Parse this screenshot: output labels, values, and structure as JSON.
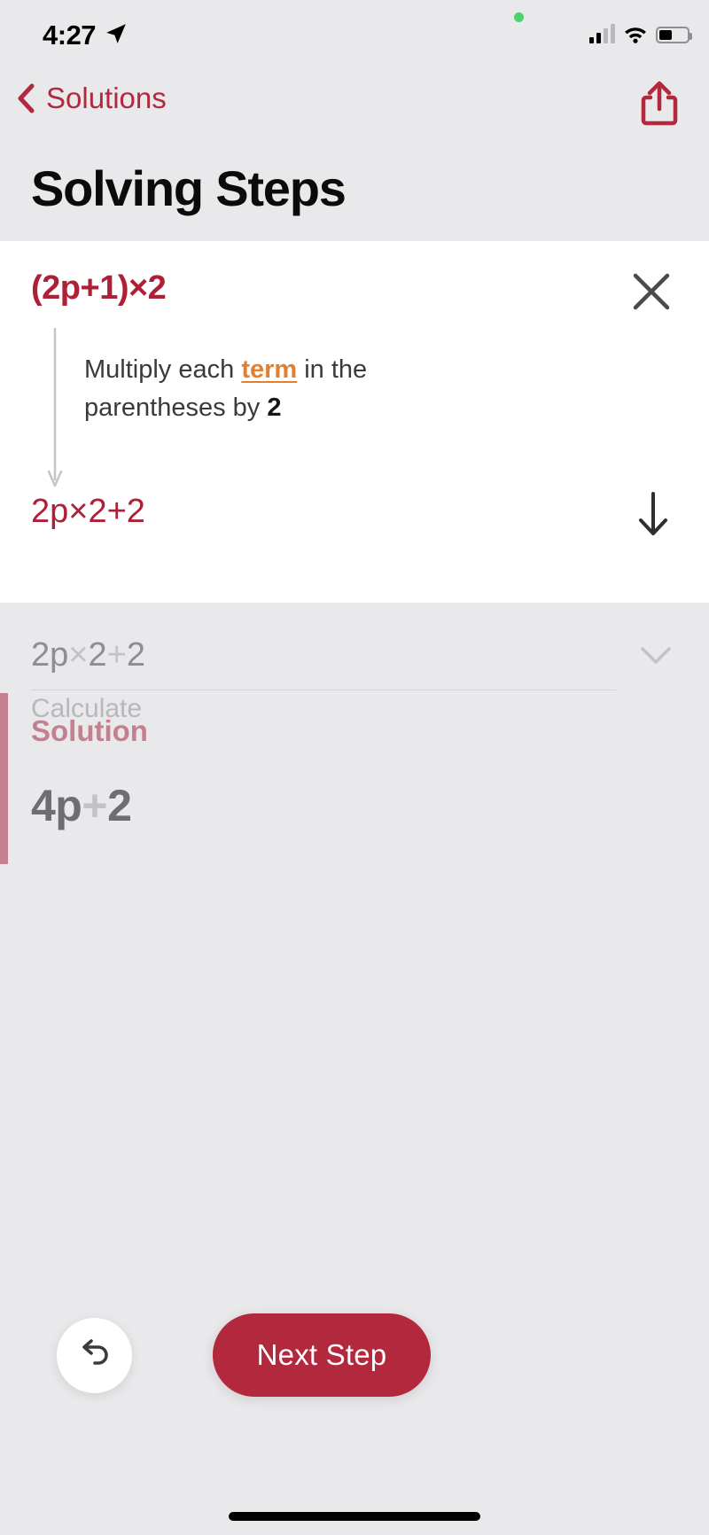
{
  "status_bar": {
    "time": "4:27",
    "location_icon": "location-arrow-icon",
    "recording_indicator": "green-recording-dot",
    "signal_icon": "cellular-signal-icon",
    "wifi_icon": "wifi-icon",
    "battery_icon": "battery-icon",
    "battery_level_percent": 45
  },
  "nav": {
    "back_label": "Solutions",
    "back_icon": "chevron-left-icon",
    "share_icon": "share-icon"
  },
  "header": {
    "title": "Solving Steps"
  },
  "active_step": {
    "expression": "(2p+1)×2",
    "close_icon": "close-x-icon",
    "description_prefix": "Multiply each ",
    "description_link": "term",
    "description_middle": " in the parentheses by ",
    "description_number": "2",
    "result": "2p×2+2",
    "down_icon": "arrow-down-icon",
    "flow_arrow_icon": "flow-arrow-down-icon"
  },
  "next_step": {
    "expression_a": "2p",
    "expression_times": "×",
    "expression_b": "2",
    "expression_plus": "+",
    "expression_c": "2",
    "label": "Calculate",
    "chevron_icon": "chevron-down-icon"
  },
  "solution": {
    "title": "Solution",
    "value_a": "4p",
    "value_plus": "+",
    "value_b": "2"
  },
  "actions": {
    "undo_icon": "undo-arrow-icon",
    "next_step_label": "Next Step"
  },
  "colors": {
    "accent_red": "#b2283c",
    "expression_red": "#ad2036",
    "link_orange": "#e2802f",
    "solution_rose": "#c4808f",
    "page_background": "#e9e9eb",
    "card_background": "#ffffff"
  },
  "home_indicator": "home-indicator-bar"
}
